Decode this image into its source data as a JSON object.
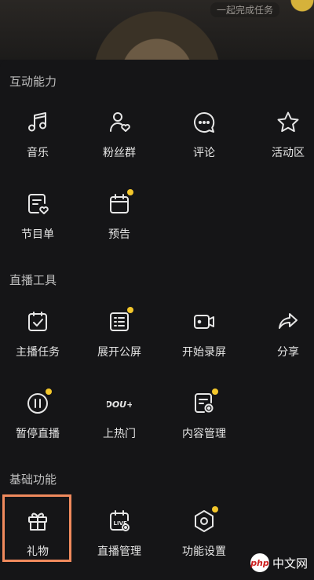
{
  "top_banner": {
    "task_text": "一起完成任务"
  },
  "sections": {
    "interaction": {
      "title": "互动能力",
      "items": [
        "音乐",
        "粉丝群",
        "评论",
        "活动区",
        "节目单",
        "预告"
      ]
    },
    "live_tools": {
      "title": "直播工具",
      "items": [
        "主播任务",
        "展开公屏",
        "开始录屏",
        "分享",
        "暂停直播",
        "上热门",
        "内容管理"
      ]
    },
    "basic": {
      "title": "基础功能",
      "items": [
        "礼物",
        "直播管理",
        "功能设置"
      ]
    }
  },
  "watermark": {
    "logo": "php",
    "text": "中文网"
  },
  "colors": {
    "background": "#151517",
    "badge": "#f3c62b",
    "highlight": "#f08a5d"
  }
}
